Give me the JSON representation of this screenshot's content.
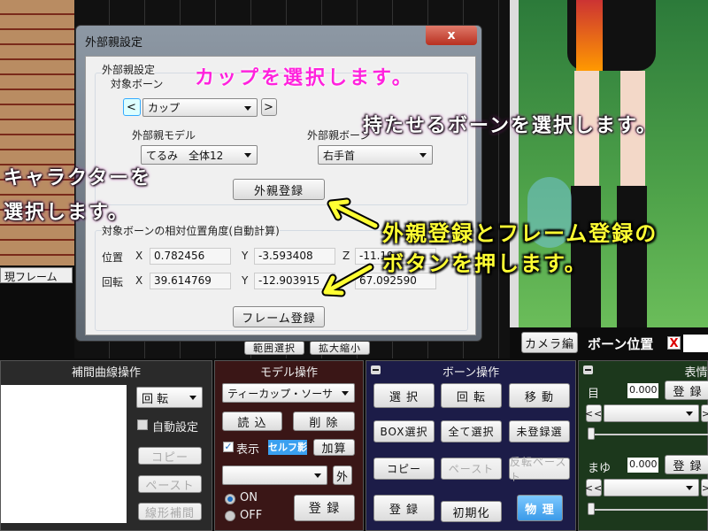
{
  "timeline": {
    "current_frame_label": "現フレーム"
  },
  "dialog": {
    "title": "外部親設定",
    "close_label": "x",
    "group1_label": "外部親設定",
    "target_bone_label": "対象ボーン",
    "target_bone_value": "カップ",
    "prev_label": "<",
    "next_label": ">",
    "parent_model_label": "外部親モデル",
    "parent_model_value": "てるみ　全体12",
    "parent_bone_label": "外部親ボーン",
    "parent_bone_value": "右手首",
    "register_parent_button": "外親登録",
    "group2_label": "対象ボーンの相対位置角度(自動計算)",
    "position_label": "位置",
    "rotation_label": "回転",
    "x": "X",
    "y": "Y",
    "z": "Z",
    "pos_x": "0.782456",
    "pos_y": "-3.593408",
    "pos_z": "-11.19",
    "rot_x": "39.614769",
    "rot_y": "-12.903915",
    "rot_z": "67.092590",
    "frame_register_button": "フレーム登録"
  },
  "behind_buttons": [
    "範囲選択",
    "拡大縮小"
  ],
  "camera_bar": {
    "camera_button": "カメラ編",
    "bone_position_label": "ボーン位置",
    "x_icon": "X"
  },
  "interp_panel": {
    "title": "補間曲線操作",
    "rotation_select": "回 転",
    "auto_label": "自動設定",
    "copy": "コピー",
    "paste": "ペースト",
    "linear": "線形補間"
  },
  "model_panel": {
    "title": "モデル操作",
    "model_select": "ティーカップ・ソーサ",
    "load": "読 込",
    "delete": "削 除",
    "display": "表示",
    "self_shadow": "セルフ影",
    "add": "加算",
    "outer": "外",
    "on": "ON",
    "off": "OFF",
    "register": "登 録"
  },
  "bone_panel": {
    "title": "ボーン操作",
    "buttons": [
      "選 択",
      "回 転",
      "移 動",
      "BOX選択",
      "全て選択",
      "未登録選",
      "コピー",
      "ペースト",
      "反転ペースト",
      "登 録",
      "初期化",
      "物 理"
    ]
  },
  "morph_panel": {
    "title": "表情",
    "eye_label": "目",
    "eye_value": "0.000",
    "brow_label": "まゆ",
    "brow_value": "0.000",
    "register": "登 録",
    "prev": "<<",
    "next": ">"
  },
  "annotations": {
    "select_cup": "カップを選択します。",
    "select_bone": "持たせるボーンを選択します。",
    "select_char_1": "キャラクターを",
    "select_char_2": "選択します。",
    "press_1": "外親登録とフレーム登録の",
    "press_2": "ボタンを押します。"
  },
  "colors": {
    "annotation_pink": "#ff22dd",
    "annotation_yellow": "#ffff33",
    "model_panel": "#3a1616",
    "bone_panel": "#1c1c48",
    "morph_panel": "#1c381c",
    "physics_button": "#3aa0f0"
  }
}
